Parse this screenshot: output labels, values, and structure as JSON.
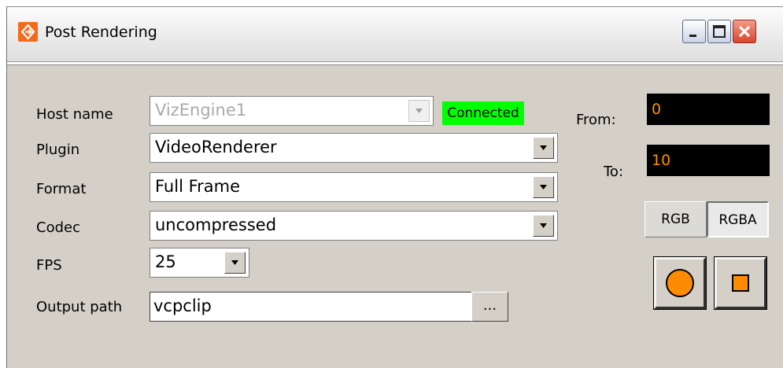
{
  "window": {
    "title": "Post Rendering"
  },
  "form": {
    "host_label": "Host name",
    "host_value": "VizEngine1",
    "connection_status": "Connected",
    "plugin_label": "Plugin",
    "plugin_value": "VideoRenderer",
    "format_label": "Format",
    "format_value": "Full Frame",
    "codec_label": "Codec",
    "codec_value": "uncompressed",
    "fps_label": "FPS",
    "fps_value": "25",
    "output_label": "Output path",
    "output_value": "vcpclip",
    "browse_label": "..."
  },
  "range": {
    "from_label": "From:",
    "from_value": "0",
    "to_label": "To:",
    "to_value": "10"
  },
  "mode": {
    "rgb_label": "RGB",
    "rgba_label": "RGBA",
    "selected": "RGBA"
  },
  "icons": {
    "app": "post-rendering-app-icon",
    "minimize": "minimize-icon",
    "maximize": "maximize-icon",
    "close": "close-icon",
    "dropdown": "chevron-down-icon",
    "record": "record-circle-icon",
    "stop": "stop-square-icon"
  },
  "colors": {
    "connected_bg": "#00ff00",
    "range_text": "#ff8c00",
    "accent_icon": "#f26a1b",
    "record_fill": "#ff8c00"
  }
}
